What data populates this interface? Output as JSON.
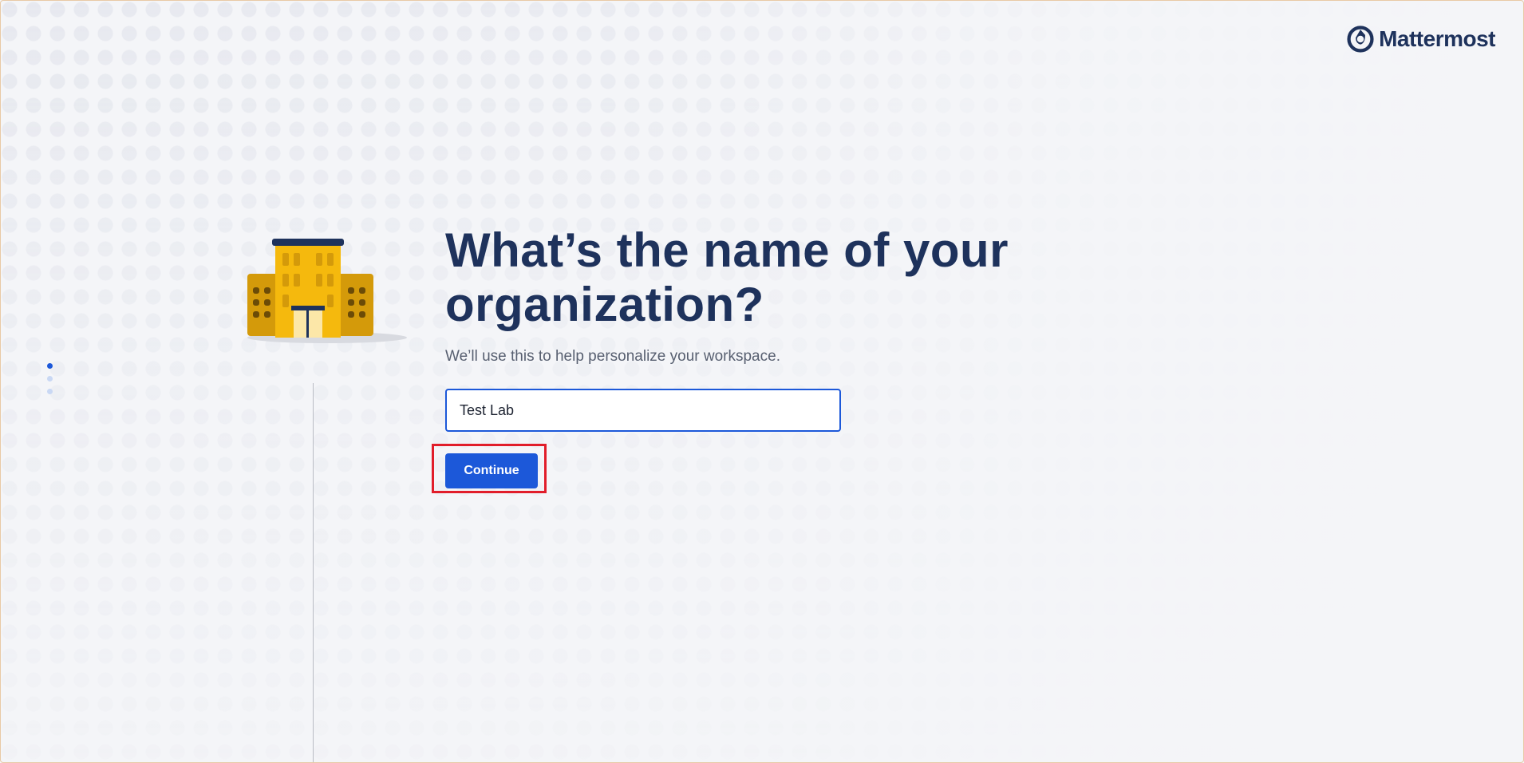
{
  "brand": {
    "name": "Mattermost",
    "logo_icon": "mattermost-logo-icon"
  },
  "progress": {
    "total_steps": 3,
    "current_step": 1
  },
  "illustration": {
    "icon": "office-building-icon"
  },
  "main": {
    "title": "What’s the name of your organization?",
    "subtitle": "We’ll use this to help personalize your workspace.",
    "org_input_value": "Test Lab",
    "continue_label": "Continue"
  },
  "colors": {
    "accent": "#1c58d9",
    "heading": "#1e325c",
    "highlight": "#e11d2a",
    "building": "#f5b90d"
  }
}
